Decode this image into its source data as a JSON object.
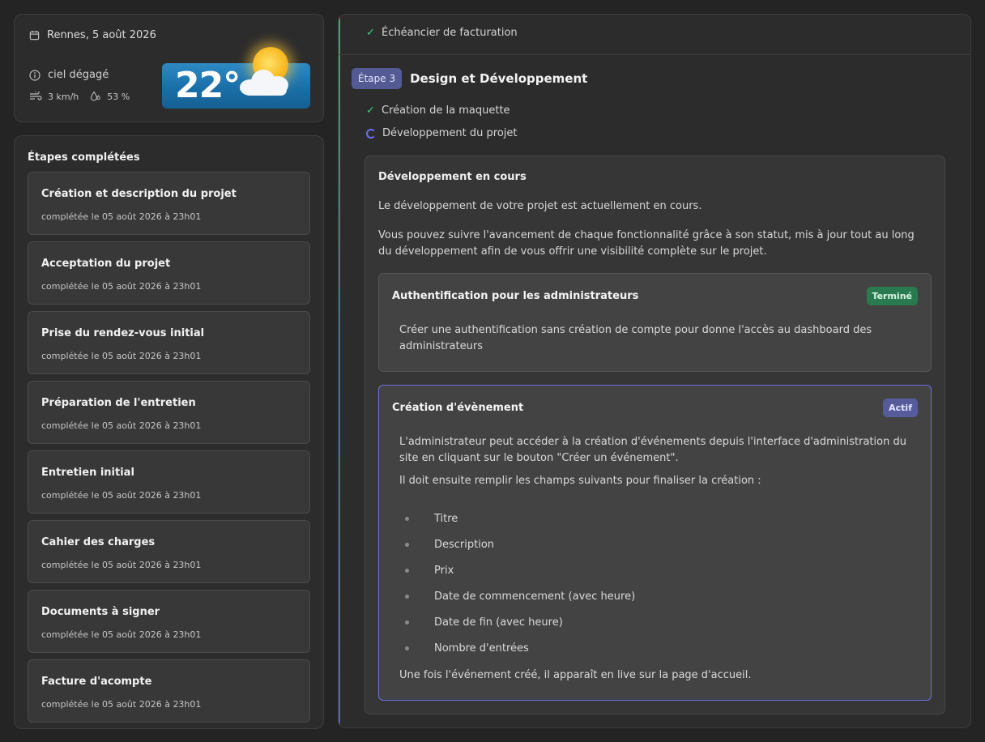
{
  "weather": {
    "location_date": "Rennes, 5 août 2026",
    "condition": "ciel dégagé",
    "wind": "3 km/h",
    "humidity": "53 %",
    "temperature": "22°"
  },
  "completed_steps": {
    "title": "Étapes complétées",
    "items": [
      {
        "title": "Création et description du projet",
        "completed": "complétée le 05 août 2026 à 23h01"
      },
      {
        "title": "Acceptation du projet",
        "completed": "complétée le 05 août 2026 à 23h01"
      },
      {
        "title": "Prise du rendez-vous initial",
        "completed": "complétée le 05 août 2026 à 23h01"
      },
      {
        "title": "Préparation de l'entretien",
        "completed": "complétée le 05 août 2026 à 23h01"
      },
      {
        "title": "Entretien initial",
        "completed": "complétée le 05 août 2026 à 23h01"
      },
      {
        "title": "Cahier des charges",
        "completed": "complétée le 05 août 2026 à 23h01"
      },
      {
        "title": "Documents à signer",
        "completed": "complétée le 05 août 2026 à 23h01"
      },
      {
        "title": "Facture d'acompte",
        "completed": "complétée le 05 août 2026 à 23h01"
      }
    ]
  },
  "main": {
    "billing_label": "Échéancier de facturation",
    "step_chip": "Étape 3",
    "step_title": "Design et Développement",
    "sub_items": [
      {
        "label": "Création de la maquette",
        "status": "done"
      },
      {
        "label": "Développement du projet",
        "status": "in-progress"
      }
    ],
    "dev": {
      "title": "Développement en cours",
      "p1": "Le développement de votre projet est actuellement en cours.",
      "p2": "Vous pouvez suivre l'avancement de chaque fonctionnalité grâce à son statut, mis à jour tout au long du développement afin de vous offrir une visibilité complète sur le projet.",
      "features": [
        {
          "title": "Authentification pour les administrateurs",
          "badge": "Terminé",
          "text": "Créer une authentification sans création de compte pour donne l'accès au dashboard des administrateurs"
        },
        {
          "title": "Création d'évènement",
          "badge": "Actif",
          "text1": "L'administrateur peut accéder à la création d'événements depuis l'interface d'administration du site en cliquant sur le bouton \"Créer un événement\".",
          "text2": "Il doit ensuite remplir les champs suivants pour finaliser la création :",
          "fields": [
            "Titre",
            "Description",
            "Prix",
            "Date de commencement (avec heure)",
            "Date de fin (avec heure)",
            "Nombre d'entrées"
          ],
          "text3": "Une fois l'événement créé, il apparaît en live sur la page d'accueil."
        }
      ]
    }
  }
}
